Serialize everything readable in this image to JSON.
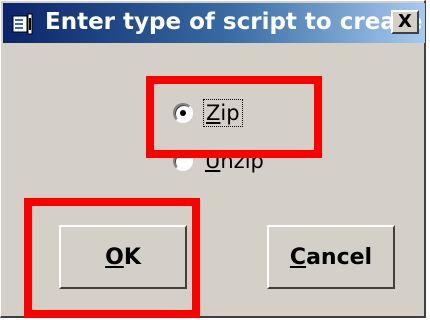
{
  "window": {
    "title": "Enter type of script to create",
    "close_label": "X"
  },
  "options": {
    "zip_label": "Zip",
    "zip_selected": true,
    "unzip_label": "Unzip",
    "unzip_selected": false
  },
  "buttons": {
    "ok_label": "OK",
    "cancel_label": "Cancel"
  },
  "colors": {
    "titlebar_start": "#0a246a",
    "titlebar_end": "#a6caf0",
    "dialog_face": "#d4d0c8",
    "highlight": "#ff0000"
  },
  "icons": [
    "script-app-icon",
    "close-icon"
  ]
}
